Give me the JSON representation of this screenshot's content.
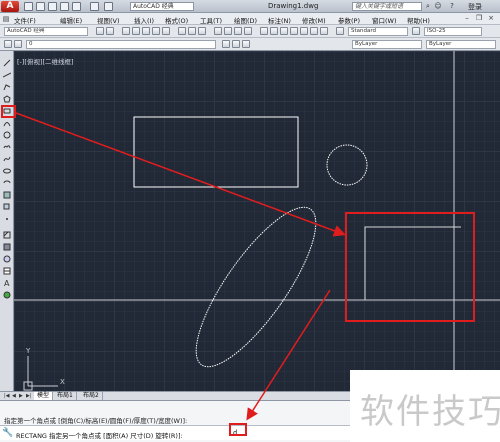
{
  "titlebar": {
    "app_logo": "A",
    "workspace": "AutoCAD 经典",
    "document_title": "Drawing1.dwg",
    "search_placeholder": "键入关键字或短语",
    "login_label": "登录"
  },
  "menu": {
    "items": [
      "文件(F)",
      "编辑(E)",
      "视图(V)",
      "插入(I)",
      "格式(O)",
      "工具(T)",
      "绘图(D)",
      "标注(N)",
      "修改(M)",
      "参数(P)",
      "窗口(W)",
      "帮助(H)"
    ]
  },
  "toolbar": {
    "workspace_combo": "AutoCAD 经典",
    "text_style": "Standard",
    "dim_style": "ISO-25",
    "layer_combo": "0",
    "color_combo": "ByLayer",
    "linetype_combo": "ByLayer"
  },
  "viewport": {
    "label": "[-][俯视][二维线框]",
    "ucs_y": "Y",
    "ucs_x": "X"
  },
  "tabs": {
    "items": [
      "模型",
      "布局1",
      "布局2"
    ],
    "active_index": 0
  },
  "command": {
    "history": "指定第一个角点或 [倒角(C)/标高(E)/圆角(F)/厚度(T)/宽度(W)]:",
    "prompt": "RECTANG 指定另一个角点或 [面积(A) 尺寸(D) 旋转(R)]:",
    "input_value": "d"
  },
  "watermark": "软件技巧",
  "colors": {
    "annotation": "#e01d1d",
    "canvas": "#212836",
    "geometry": "#ffffff"
  }
}
